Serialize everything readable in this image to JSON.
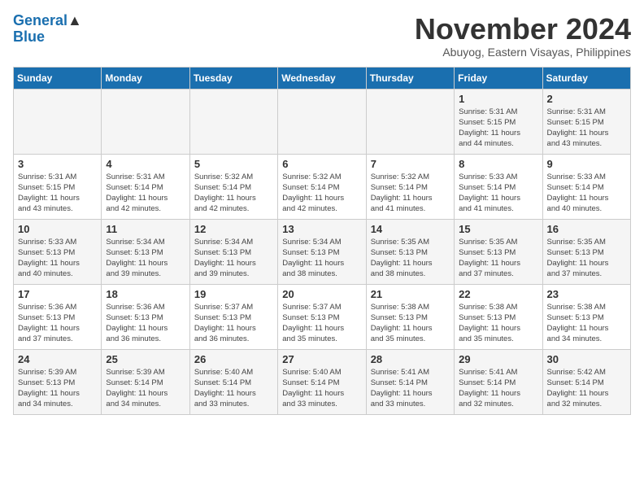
{
  "header": {
    "logo_top": "General",
    "logo_bottom": "Blue",
    "month_title": "November 2024",
    "location": "Abuyog, Eastern Visayas, Philippines"
  },
  "days_of_week": [
    "Sunday",
    "Monday",
    "Tuesday",
    "Wednesday",
    "Thursday",
    "Friday",
    "Saturday"
  ],
  "weeks": [
    [
      {
        "day": "",
        "info": ""
      },
      {
        "day": "",
        "info": ""
      },
      {
        "day": "",
        "info": ""
      },
      {
        "day": "",
        "info": ""
      },
      {
        "day": "",
        "info": ""
      },
      {
        "day": "1",
        "info": "Sunrise: 5:31 AM\nSunset: 5:15 PM\nDaylight: 11 hours\nand 44 minutes."
      },
      {
        "day": "2",
        "info": "Sunrise: 5:31 AM\nSunset: 5:15 PM\nDaylight: 11 hours\nand 43 minutes."
      }
    ],
    [
      {
        "day": "3",
        "info": "Sunrise: 5:31 AM\nSunset: 5:15 PM\nDaylight: 11 hours\nand 43 minutes."
      },
      {
        "day": "4",
        "info": "Sunrise: 5:31 AM\nSunset: 5:14 PM\nDaylight: 11 hours\nand 42 minutes."
      },
      {
        "day": "5",
        "info": "Sunrise: 5:32 AM\nSunset: 5:14 PM\nDaylight: 11 hours\nand 42 minutes."
      },
      {
        "day": "6",
        "info": "Sunrise: 5:32 AM\nSunset: 5:14 PM\nDaylight: 11 hours\nand 42 minutes."
      },
      {
        "day": "7",
        "info": "Sunrise: 5:32 AM\nSunset: 5:14 PM\nDaylight: 11 hours\nand 41 minutes."
      },
      {
        "day": "8",
        "info": "Sunrise: 5:33 AM\nSunset: 5:14 PM\nDaylight: 11 hours\nand 41 minutes."
      },
      {
        "day": "9",
        "info": "Sunrise: 5:33 AM\nSunset: 5:14 PM\nDaylight: 11 hours\nand 40 minutes."
      }
    ],
    [
      {
        "day": "10",
        "info": "Sunrise: 5:33 AM\nSunset: 5:13 PM\nDaylight: 11 hours\nand 40 minutes."
      },
      {
        "day": "11",
        "info": "Sunrise: 5:34 AM\nSunset: 5:13 PM\nDaylight: 11 hours\nand 39 minutes."
      },
      {
        "day": "12",
        "info": "Sunrise: 5:34 AM\nSunset: 5:13 PM\nDaylight: 11 hours\nand 39 minutes."
      },
      {
        "day": "13",
        "info": "Sunrise: 5:34 AM\nSunset: 5:13 PM\nDaylight: 11 hours\nand 38 minutes."
      },
      {
        "day": "14",
        "info": "Sunrise: 5:35 AM\nSunset: 5:13 PM\nDaylight: 11 hours\nand 38 minutes."
      },
      {
        "day": "15",
        "info": "Sunrise: 5:35 AM\nSunset: 5:13 PM\nDaylight: 11 hours\nand 37 minutes."
      },
      {
        "day": "16",
        "info": "Sunrise: 5:35 AM\nSunset: 5:13 PM\nDaylight: 11 hours\nand 37 minutes."
      }
    ],
    [
      {
        "day": "17",
        "info": "Sunrise: 5:36 AM\nSunset: 5:13 PM\nDaylight: 11 hours\nand 37 minutes."
      },
      {
        "day": "18",
        "info": "Sunrise: 5:36 AM\nSunset: 5:13 PM\nDaylight: 11 hours\nand 36 minutes."
      },
      {
        "day": "19",
        "info": "Sunrise: 5:37 AM\nSunset: 5:13 PM\nDaylight: 11 hours\nand 36 minutes."
      },
      {
        "day": "20",
        "info": "Sunrise: 5:37 AM\nSunset: 5:13 PM\nDaylight: 11 hours\nand 35 minutes."
      },
      {
        "day": "21",
        "info": "Sunrise: 5:38 AM\nSunset: 5:13 PM\nDaylight: 11 hours\nand 35 minutes."
      },
      {
        "day": "22",
        "info": "Sunrise: 5:38 AM\nSunset: 5:13 PM\nDaylight: 11 hours\nand 35 minutes."
      },
      {
        "day": "23",
        "info": "Sunrise: 5:38 AM\nSunset: 5:13 PM\nDaylight: 11 hours\nand 34 minutes."
      }
    ],
    [
      {
        "day": "24",
        "info": "Sunrise: 5:39 AM\nSunset: 5:13 PM\nDaylight: 11 hours\nand 34 minutes."
      },
      {
        "day": "25",
        "info": "Sunrise: 5:39 AM\nSunset: 5:14 PM\nDaylight: 11 hours\nand 34 minutes."
      },
      {
        "day": "26",
        "info": "Sunrise: 5:40 AM\nSunset: 5:14 PM\nDaylight: 11 hours\nand 33 minutes."
      },
      {
        "day": "27",
        "info": "Sunrise: 5:40 AM\nSunset: 5:14 PM\nDaylight: 11 hours\nand 33 minutes."
      },
      {
        "day": "28",
        "info": "Sunrise: 5:41 AM\nSunset: 5:14 PM\nDaylight: 11 hours\nand 33 minutes."
      },
      {
        "day": "29",
        "info": "Sunrise: 5:41 AM\nSunset: 5:14 PM\nDaylight: 11 hours\nand 32 minutes."
      },
      {
        "day": "30",
        "info": "Sunrise: 5:42 AM\nSunset: 5:14 PM\nDaylight: 11 hours\nand 32 minutes."
      }
    ]
  ]
}
